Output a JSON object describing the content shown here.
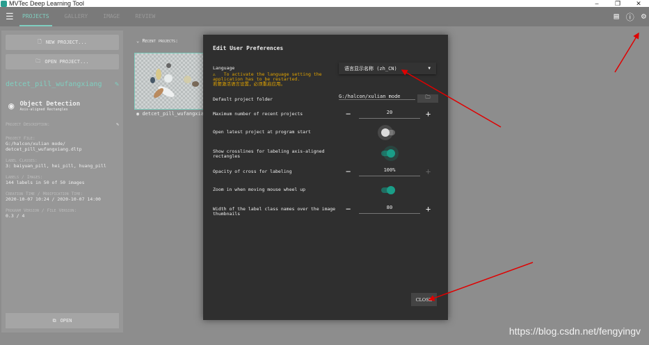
{
  "window": {
    "title": "MVTec Deep Learning Tool",
    "controls": [
      "–",
      "❐",
      "✕"
    ]
  },
  "toolbar": {
    "tabs": [
      "PROJECTS",
      "GALLERY",
      "IMAGE",
      "REVIEW"
    ],
    "icons": [
      "feedback-icon",
      "help-icon",
      "gear-icon"
    ]
  },
  "left": {
    "new_project": "NEW PROJECT...",
    "open_project": "OPEN PROJECT...",
    "project_name": "detcet_pill_wufangxiang",
    "type_title": "Object Detection",
    "type_sub": "Axis-aligned Rectangles",
    "desc_label": "Project Description:",
    "file_label": "Project File:",
    "file_value": "G:/halcon/xulian mode/ detcet_pill_wufangxiang.dltp",
    "classes_label": "Label Classes:",
    "classes_value": "3: baiyuan_pill, hei_pill, huang_pill",
    "labels_label": "Labels / Images:",
    "labels_value": "144 labels in 50 of 50 images",
    "time_label": "Creation Time / Modification Time:",
    "time_value": "2020-10-07 10:24 / 2020-10-07 14:00",
    "version_label": "Program Version / File Version:",
    "version_value": "0.3 / 4",
    "open": "OPEN"
  },
  "recent": {
    "heading": "Recent projects:",
    "item": "detcet_pill_wufangxiang"
  },
  "dialog": {
    "title": "Edit User Preferences",
    "language_label": "Language",
    "language_value": "语言显示名称 (zh_CN)",
    "warning_en": "To activate the language setting the application has to be restarted.",
    "warning_cn": "若要激活语言设置，必须重启应用。",
    "folder_label": "Default project folder",
    "folder_value": "G:/halcon/xulian mode",
    "max_recent_label": "Maximum number of recent projects",
    "max_recent_value": "20",
    "open_latest_label": "Open latest project at program start",
    "open_latest_on": false,
    "crosslines_label": "Show crosslines for labeling axis-aligned rectangles",
    "crosslines_on": true,
    "opacity_label": "Opacity of cross for labeling",
    "opacity_value": "100%",
    "zoom_label": "Zoom in when moving mouse wheel up",
    "zoom_on": true,
    "width_label": "Width of the label class names over the image thumbnails",
    "width_value": "80",
    "close": "CLOSE"
  },
  "watermark": "https://blog.csdn.net/fengyingv",
  "colors": {
    "accent": "#7fcfc0",
    "toggle_on": "#1a9e88",
    "warning": "#e0a300",
    "arrow": "#e00000"
  }
}
